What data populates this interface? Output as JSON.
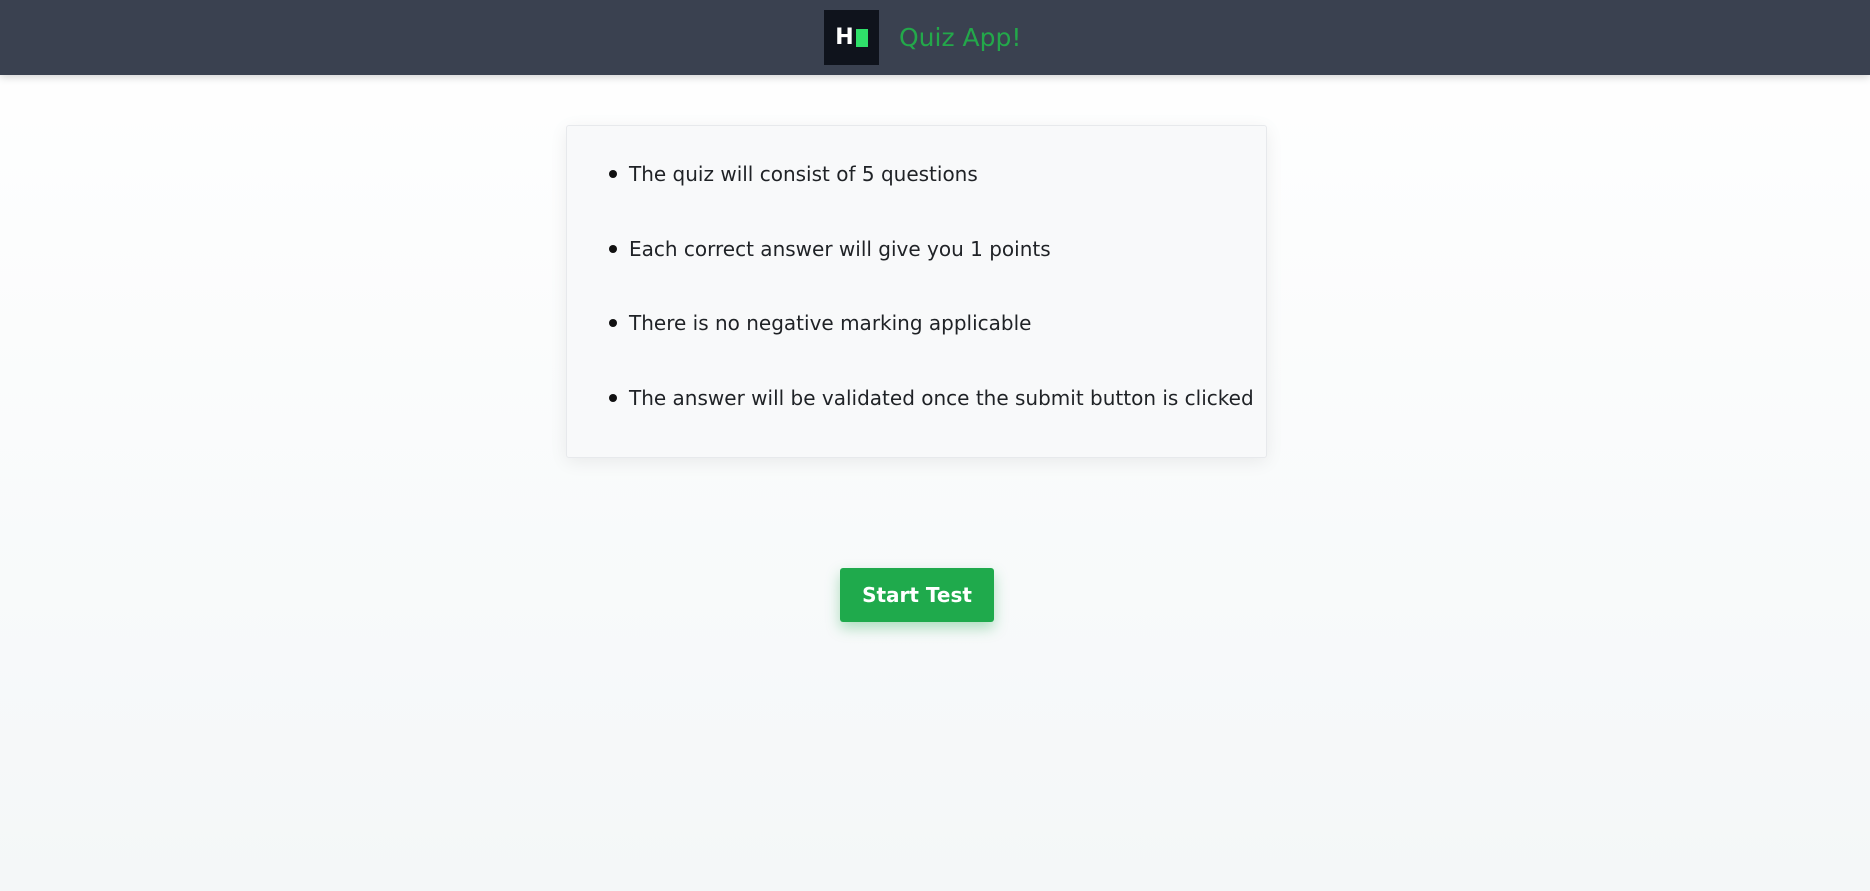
{
  "header": {
    "logo_letter": "H",
    "title": "Quiz App!"
  },
  "rules": [
    "The quiz will consist of 5 questions",
    "Each correct answer will give you 1 points",
    "There is no negative marking applicable",
    "The answer will be validated once the submit button is clicked"
  ],
  "actions": {
    "start_label": "Start Test"
  },
  "colors": {
    "header_bg": "#3a4150",
    "accent_green": "#23a84a",
    "button_bg": "#1faa4c"
  },
  "icons": {
    "logo": "h-block-logo-icon",
    "bullet": "bullet-dot-icon"
  }
}
